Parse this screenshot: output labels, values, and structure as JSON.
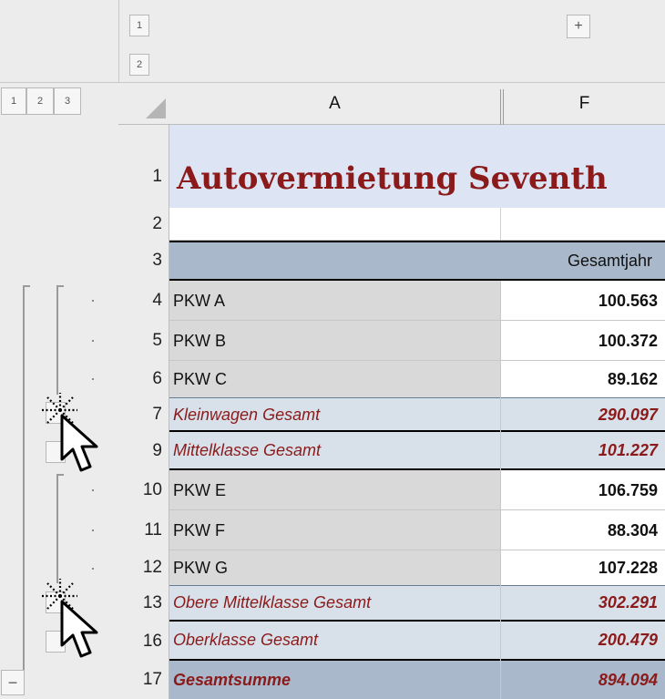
{
  "outline": {
    "col_levels": [
      "1",
      "2"
    ],
    "row_levels": [
      "1",
      "2",
      "3"
    ],
    "col_expand": "+",
    "row_collapse": "−"
  },
  "columns": [
    {
      "letter": "A"
    },
    {
      "letter": "F"
    }
  ],
  "title_row": {
    "row": "1",
    "text": "Autovermietung Seventh"
  },
  "blank_row": {
    "row": "2"
  },
  "header_row": {
    "row": "3",
    "gesamtjahr": "Gesamtjahr"
  },
  "rows": [
    {
      "row": "4",
      "label": "PKW A",
      "value": "100.563",
      "type": "detail"
    },
    {
      "row": "5",
      "label": "PKW B",
      "value": "100.372",
      "type": "detail"
    },
    {
      "row": "6",
      "label": "PKW C",
      "value": "89.162",
      "type": "detail"
    },
    {
      "row": "7",
      "label": "Kleinwagen Gesamt",
      "value": "290.097",
      "type": "subtotal"
    },
    {
      "row": "9",
      "label": "Mittelklasse Gesamt",
      "value": "101.227",
      "type": "subtotal"
    },
    {
      "row": "10",
      "label": "PKW E",
      "value": "106.759",
      "type": "detail"
    },
    {
      "row": "11",
      "label": "PKW F",
      "value": "88.304",
      "type": "detail"
    },
    {
      "row": "12",
      "label": "PKW G",
      "value": "107.228",
      "type": "detail"
    },
    {
      "row": "13",
      "label": "Obere Mittelklasse Gesamt",
      "value": "302.291",
      "type": "subtotal"
    },
    {
      "row": "16",
      "label": "Oberklasse Gesamt",
      "value": "200.479",
      "type": "subtotal"
    },
    {
      "row": "17",
      "label": "Gesamtsumme",
      "value": "894.094",
      "type": "total"
    }
  ],
  "colors": {
    "title": "#8b1a1a",
    "title_bg": "#dde4f3",
    "header_bg": "#a9b9cb",
    "subtotal_bg": "#d8e1ea",
    "label_bg": "#d9d9d9",
    "subtotal_text": "#8b1a1a"
  },
  "icons": [
    "click-burst-icon",
    "mouse-pointer-icon"
  ]
}
